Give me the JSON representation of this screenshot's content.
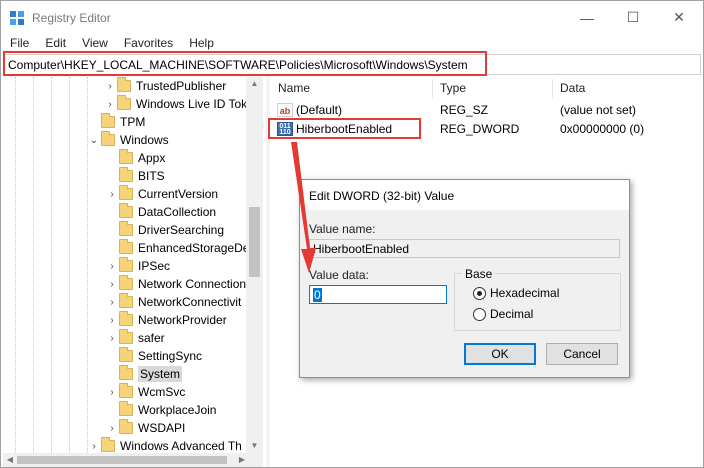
{
  "window": {
    "title": "Registry Editor",
    "controls": {
      "minimize": "—",
      "maximize": "☐",
      "close": "✕"
    }
  },
  "menu": [
    "File",
    "Edit",
    "View",
    "Favorites",
    "Help"
  ],
  "address": "Computer\\HKEY_LOCAL_MACHINE\\SOFTWARE\\Policies\\Microsoft\\Windows\\System",
  "tree": {
    "items": [
      {
        "label": "TrustedPublisher",
        "expander": "›"
      },
      {
        "label": "Windows Live ID Tok",
        "expander": "›"
      },
      {
        "label": "TPM",
        "expander": ""
      },
      {
        "label": "Windows",
        "expander": "⌄"
      },
      {
        "label": "Appx",
        "expander": ""
      },
      {
        "label": "BITS",
        "expander": ""
      },
      {
        "label": "CurrentVersion",
        "expander": "›"
      },
      {
        "label": "DataCollection",
        "expander": ""
      },
      {
        "label": "DriverSearching",
        "expander": ""
      },
      {
        "label": "EnhancedStorageDe",
        "expander": ""
      },
      {
        "label": "IPSec",
        "expander": "›"
      },
      {
        "label": "Network Connection",
        "expander": "›"
      },
      {
        "label": "NetworkConnectivit",
        "expander": "›"
      },
      {
        "label": "NetworkProvider",
        "expander": "›"
      },
      {
        "label": "safer",
        "expander": "›"
      },
      {
        "label": "SettingSync",
        "expander": ""
      },
      {
        "label": "System",
        "expander": "",
        "selected": true
      },
      {
        "label": "WcmSvc",
        "expander": "›"
      },
      {
        "label": "WorkplaceJoin",
        "expander": ""
      },
      {
        "label": "WSDAPI",
        "expander": "›"
      },
      {
        "label": "Windows Advanced Th",
        "expander": "›"
      }
    ]
  },
  "values": {
    "headers": {
      "name": "Name",
      "type": "Type",
      "data": "Data"
    },
    "rows": [
      {
        "icon": "ab",
        "name": "(Default)",
        "type": "REG_SZ",
        "data": "(value not set)"
      },
      {
        "icon": "binary",
        "name": "HiberbootEnabled",
        "type": "REG_DWORD",
        "data": "0x00000000 (0)"
      }
    ]
  },
  "dialog": {
    "title": "Edit DWORD (32-bit) Value",
    "value_name_label": "Value name:",
    "value_name": "HiberbootEnabled",
    "value_data_label": "Value data:",
    "value_data": "0",
    "base_label": "Base",
    "radios": {
      "hex": "Hexadecimal",
      "dec": "Decimal"
    },
    "selected_base": "hex",
    "ok": "OK",
    "cancel": "Cancel"
  },
  "colors": {
    "highlight": "#e53935",
    "accent": "#0078d7"
  },
  "icon_glyphs": {
    "ab": "ab",
    "binary": "011 110"
  }
}
